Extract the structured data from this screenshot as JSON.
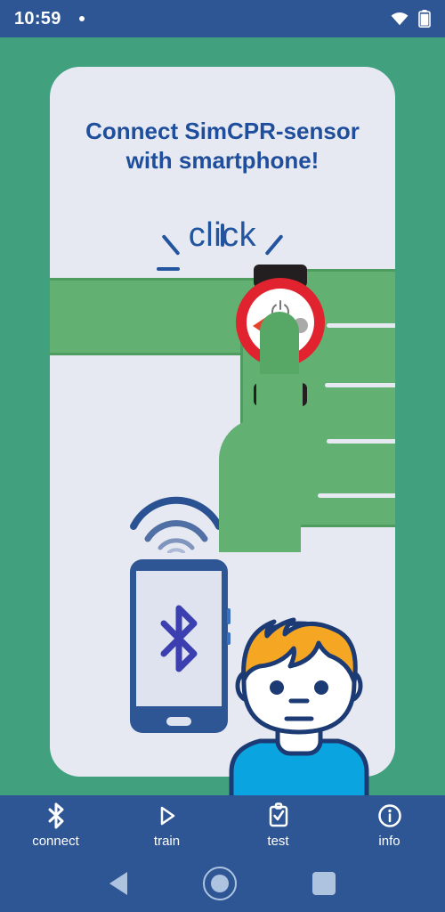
{
  "status_bar": {
    "time": "10:59",
    "notification_dot": "•",
    "wifi_icon": "wifi-icon",
    "battery_icon": "battery-icon"
  },
  "card": {
    "title_line1": "Connect SimCPR-sensor",
    "title_line2": "with smartphone!",
    "click_label": "click"
  },
  "illustration": {
    "sensor_icon": "cpr-sensor-watch-icon",
    "power_icon": "power-icon",
    "hand_icon": "hand-pressing-icon",
    "bluetooth_icon": "bluetooth-icon",
    "wireless_icon": "wireless-signal-icon",
    "phone_icon": "smartphone-icon",
    "avatar_icon": "boy-avatar-icon"
  },
  "bottom_nav": {
    "items": [
      {
        "label": "connect",
        "icon": "bluetooth-icon",
        "active": true
      },
      {
        "label": "train",
        "icon": "play-icon",
        "active": false
      },
      {
        "label": "test",
        "icon": "clipboard-check-icon",
        "active": false
      },
      {
        "label": "info",
        "icon": "info-circle-icon",
        "active": false
      }
    ]
  },
  "android_nav": {
    "back": "back-icon",
    "home": "home-icon",
    "recents": "recents-icon"
  },
  "colors": {
    "background_green": "#41a07e",
    "nav_blue": "#2e5694",
    "card_bg": "#e6e9f2",
    "title_blue": "#1f4e9c",
    "accent_red": "#e0232e",
    "hand_green": "#62b172",
    "bluetooth_blue": "#3b3fb0",
    "hair_orange": "#f5a623",
    "shirt_blue": "#0aa5e0"
  }
}
